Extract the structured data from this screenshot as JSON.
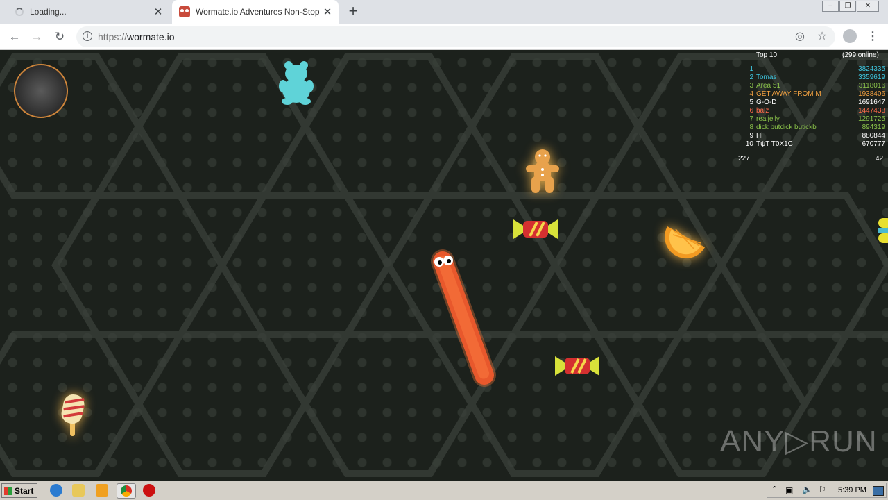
{
  "browser": {
    "tabs": [
      {
        "title": "Loading...",
        "active": false,
        "icon": "loading-spinner-icon"
      },
      {
        "title": "Wormate.io Adventures Non-Stop",
        "active": true,
        "icon": "wormate-favicon"
      }
    ],
    "new_tab_symbol": "+",
    "url_scheme": "https://",
    "url_host": "wormate.io",
    "window_controls": [
      "–",
      "❐",
      "✕"
    ]
  },
  "game": {
    "leaderboard": {
      "title": "Top 10",
      "online": "(299 online)",
      "rows": [
        {
          "rank": "1",
          "name": "",
          "score": "3824335",
          "color": "#3ec6e0"
        },
        {
          "rank": "2",
          "name": "Tomas",
          "score": "3359619",
          "color": "#3ec6e0"
        },
        {
          "rank": "3",
          "name": "Area 51",
          "score": "3118016",
          "color": "#8bc34a"
        },
        {
          "rank": "4",
          "name": "GET AWAY FROM M",
          "score": "1938406",
          "color": "#f0a040"
        },
        {
          "rank": "5",
          "name": "G-O-D",
          "score": "1691647",
          "color": "#ffffff"
        },
        {
          "rank": "6",
          "name": "balz",
          "score": "1447438",
          "color": "#ff6a4a"
        },
        {
          "rank": "7",
          "name": "realjelly",
          "score": "1291725",
          "color": "#8bc34a"
        },
        {
          "rank": "8",
          "name": "dick butdick butickb",
          "score": "894319",
          "color": "#8bc34a"
        },
        {
          "rank": "9",
          "name": "Hi",
          "score": "880844",
          "color": "#ffffff"
        },
        {
          "rank": "10",
          "name": "TψT T0X1C",
          "score": "670777",
          "color": "#ffffff"
        }
      ],
      "player_rank": "227",
      "player_score": "42"
    },
    "watermark": "ANY▷RUN"
  },
  "taskbar": {
    "start_label": "Start",
    "clock": "5:39 PM"
  }
}
